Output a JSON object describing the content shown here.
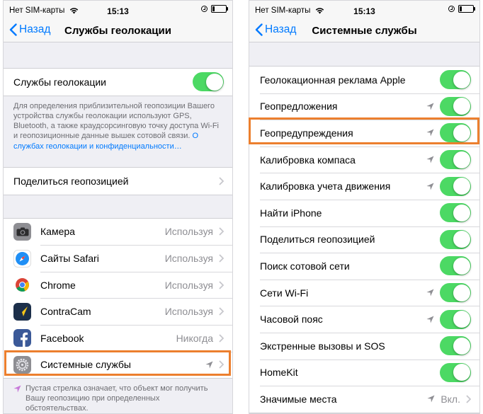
{
  "left": {
    "status": {
      "carrier": "Нет SIM-карты",
      "time": "15:13"
    },
    "nav": {
      "back": "Назад",
      "title": "Службы геолокации"
    },
    "location_services": {
      "label": "Службы геолокации",
      "on": true
    },
    "footer_text": "Для определения приблизительной геопозиции Вашего устройства службы геолокации используют GPS, Bluetooth, а также краудсорсинговую точку доступа Wi-Fi и геопозиционные данные вышек сотовой связи. ",
    "footer_link": "О службах геолокации и конфиденциальности…",
    "share_location": "Поделиться геопозицией",
    "apps": [
      {
        "name": "Камера",
        "value": "Используя",
        "icon": "camera-icon"
      },
      {
        "name": "Сайты Safari",
        "value": "Используя",
        "icon": "safari-icon"
      },
      {
        "name": "Chrome",
        "value": "Используя",
        "icon": "chrome-icon"
      },
      {
        "name": "ContraCam",
        "value": "Используя",
        "icon": "contracam-icon"
      },
      {
        "name": "Facebook",
        "value": "Никогда",
        "icon": "facebook-icon"
      },
      {
        "name": "Системные службы",
        "value": "",
        "icon": "gear-icon"
      }
    ],
    "note": "Пустая стрелка означает, что объект мог получить Вашу геопозицию при определенных обстоятельствах."
  },
  "right": {
    "status": {
      "carrier": "Нет SIM-карты",
      "time": "15:13"
    },
    "nav": {
      "back": "Назад",
      "title": "Системные службы"
    },
    "items": [
      {
        "label": "Геолокационная реклама Apple",
        "arrow": false
      },
      {
        "label": "Геопредложения",
        "arrow": true
      },
      {
        "label": "Геопредупреждения",
        "arrow": true
      },
      {
        "label": "Калибровка компаса",
        "arrow": true
      },
      {
        "label": "Калибровка учета движения",
        "arrow": true
      },
      {
        "label": "Найти iPhone",
        "arrow": false
      },
      {
        "label": "Поделиться геопозицией",
        "arrow": false
      },
      {
        "label": "Поиск сотовой сети",
        "arrow": false
      },
      {
        "label": "Сети Wi-Fi",
        "arrow": true
      },
      {
        "label": "Часовой пояс",
        "arrow": true
      },
      {
        "label": "Экстренные вызовы и SOS",
        "arrow": false
      },
      {
        "label": "HomeKit",
        "arrow": false
      }
    ],
    "significant": {
      "label": "Значимые места",
      "value": "Вкл."
    }
  },
  "colors": {
    "accent": "#007aff",
    "switch_on": "#4cd964",
    "highlight": "#ec7f2e"
  }
}
